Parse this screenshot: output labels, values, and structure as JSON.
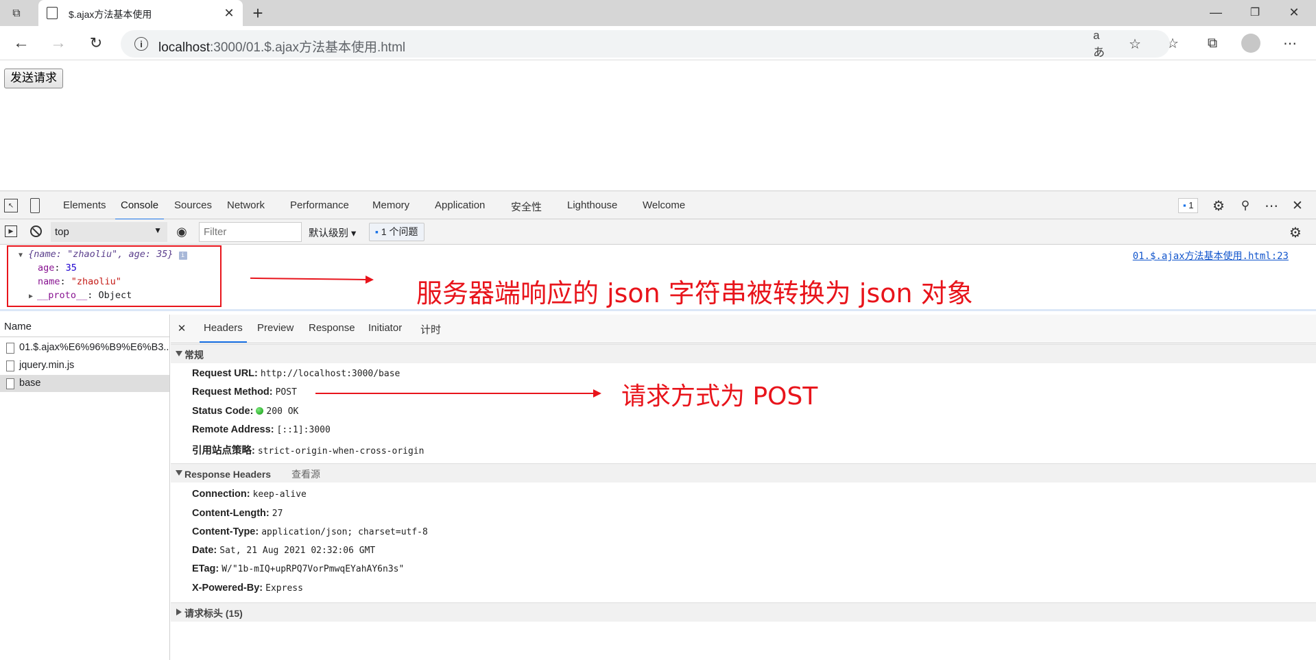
{
  "browser": {
    "tab_title": "$.ajax方法基本使用",
    "url_host": "localhost",
    "url_rest": ":3000/01.$.ajax方法基本使用.html"
  },
  "page": {
    "send_button": "发送请求"
  },
  "devtools": {
    "tabs": [
      "Elements",
      "Console",
      "Sources",
      "Network",
      "Performance",
      "Memory",
      "Application",
      "安全性",
      "Lighthouse",
      "Welcome"
    ],
    "issues_count": "1",
    "console_bar": {
      "context": "top",
      "filter_placeholder": "Filter",
      "level": "默认级别",
      "issues": "1 个问题"
    },
    "console_output": {
      "object_summary": "{name: \"zhaoliu\", age: 35}",
      "age_key": "age",
      "age_value": "35",
      "name_key": "name",
      "name_value": "\"zhaoliu\"",
      "proto_key": "__proto__",
      "proto_value": "Object",
      "source_link": "01.$.ajax方法基本使用.html:23"
    },
    "network": {
      "name_header": "Name",
      "requests": [
        "01.$.ajax%E6%96%B9%E6%B3...",
        "jquery.min.js",
        "base"
      ],
      "detail_tabs": [
        "Headers",
        "Preview",
        "Response",
        "Initiator",
        "计时"
      ],
      "general": {
        "title": "常规",
        "rows": [
          {
            "k": "Request URL:",
            "v": "http://localhost:3000/base"
          },
          {
            "k": "Request Method:",
            "v": "POST"
          },
          {
            "k": "Status Code:",
            "v": "200 OK"
          },
          {
            "k": "Remote Address:",
            "v": "[::1]:3000"
          },
          {
            "k": "引用站点策略:",
            "v": "strict-origin-when-cross-origin"
          }
        ]
      },
      "response_headers": {
        "title": "Response Headers",
        "view_source": "查看源",
        "rows": [
          {
            "k": "Connection:",
            "v": "keep-alive"
          },
          {
            "k": "Content-Length:",
            "v": "27"
          },
          {
            "k": "Content-Type:",
            "v": "application/json; charset=utf-8"
          },
          {
            "k": "Date:",
            "v": "Sat, 21 Aug 2021 02:32:06 GMT"
          },
          {
            "k": "ETag:",
            "v": "W/\"1b-mIQ+upRPQ7VorPmwqEYahAY6n3s\""
          },
          {
            "k": "X-Powered-By:",
            "v": "Express"
          }
        ]
      },
      "request_headers": {
        "title": "请求标头 (15)"
      }
    }
  },
  "annotations": {
    "json_note": "服务器端响应的 json 字符串被转换为 json 对象",
    "post_note": "请求方式为 POST",
    "color": "#e8141b"
  }
}
